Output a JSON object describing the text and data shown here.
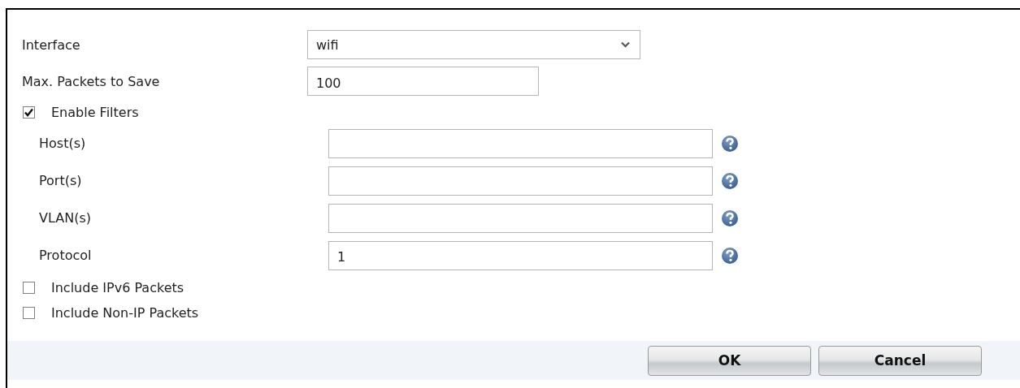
{
  "fields": [
    {
      "kind": "select",
      "label": "Interface",
      "value": "wifi"
    },
    {
      "kind": "text",
      "label": "Max. Packets to Save",
      "value": "100"
    }
  ],
  "enable_filters": {
    "label": "Enable Filters",
    "checked": true
  },
  "filters": [
    {
      "label": "Host(s)"
    },
    {
      "label": "Port(s)"
    },
    {
      "label": "VLAN(s)"
    },
    {
      "label": "Protocol",
      "value": "1"
    }
  ],
  "options": [
    {
      "label": "Include IPv6 Packets",
      "checked": false
    },
    {
      "label": "Include Non-IP Packets",
      "checked": false
    }
  ],
  "buttons": [
    {
      "label": "OK"
    },
    {
      "label": "Cancel"
    }
  ]
}
